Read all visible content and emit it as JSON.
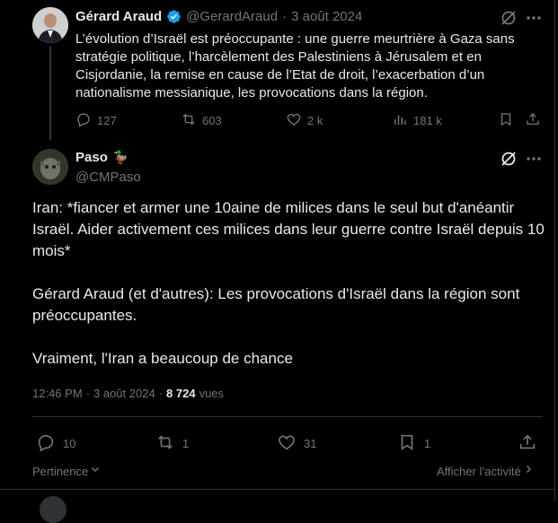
{
  "quoted_tweet": {
    "author_name": "Gérard Araud",
    "handle": "@GerardAraud",
    "separator": "·",
    "date": "3 août 2024",
    "text": "L’évolution d’Israël est préoccupante : une guerre meurtrière à Gaza sans stratégie politique, l’harcèlement des Palestiniens à Jérusalem et en Cisjordanie, la remise en cause de l’Etat de droit, l’exacerbation d’un nationalisme messianique, les provocations dans la région.",
    "replies": "127",
    "reposts": "603",
    "likes": "2 k",
    "views": "181 k"
  },
  "main_tweet": {
    "author_name": "Paso",
    "author_emoji": "🦆",
    "handle": "@CMPaso",
    "paragraph_1": "Iran: *fiancer et armer une 10aine de milices dans le seul but d'anéantir Israël. Aider activement ces milices dans leur guerre contre Israël depuis 10 mois*",
    "paragraph_2": "Gérard Araud (et d'autres): Les provocations d'Israël dans la région sont préoccupantes.",
    "paragraph_3": "Vraiment, l'Iran a beaucoup de chance",
    "time": "12:46 PM",
    "separator": "·",
    "date": "3 août 2024",
    "meta_separator": "·",
    "views_count": "8 724",
    "views_label": "vues",
    "replies": "10",
    "reposts": "1",
    "likes": "31",
    "bookmarks": "1"
  },
  "footer": {
    "sort_label": "Pertinence",
    "activity_label": "Afficher l’activité"
  },
  "colors": {
    "background": "#000000",
    "text": "#e7e9ea",
    "muted": "#71767b",
    "verified": "#1d9bf0",
    "divider": "#2f3336"
  },
  "icons": [
    "grok-icon",
    "more-icon",
    "reply-icon",
    "repost-icon",
    "like-icon",
    "views-icon",
    "bookmark-icon",
    "share-icon",
    "verified-icon",
    "chevron-down-icon",
    "chevron-right-icon"
  ]
}
